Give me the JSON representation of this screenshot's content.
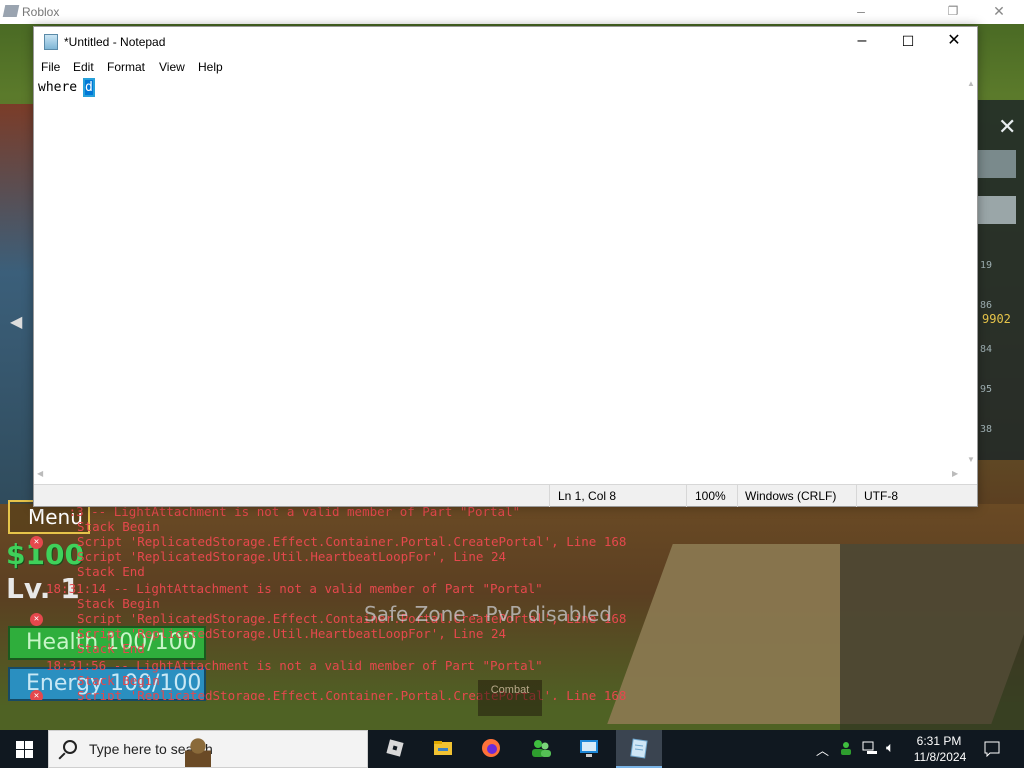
{
  "roblox": {
    "title": "Roblox",
    "hud": {
      "menu_label": "Menu",
      "money": "$100",
      "level": "Lv. 1",
      "health": "Health 100/100",
      "energy": "Energy 100/100"
    },
    "safe_zone": "Safe Zone - PvP disabled",
    "combat_label": "Combat",
    "side_panel": {
      "numbers": [
        "19",
        "86",
        "84",
        "95",
        "38"
      ],
      "gold_value": "9902"
    },
    "console_lines": [
      "   :3 -- LightAttachment is not a valid member of Part \"Portal\"",
      "  Stack Begin",
      "  Script 'ReplicatedStorage.Effect.Container.Portal.CreatePortal', Line 168",
      "  Script 'ReplicatedStorage.Util.HeartbeatLoopFor', Line 24",
      "  Stack End",
      "18:31:14 -- LightAttachment is not a valid member of Part \"Portal\"",
      "  Stack Begin",
      "  Script 'ReplicatedStorage.Effect.Container.Portal.CreatePortal', Line 168",
      "  Script 'ReplicatedStorage.Util.HeartbeatLoopFor', Line 24",
      "  Stack End",
      "18:31:56 -- LightAttachment is not a valid member of Part \"Portal\"",
      "  Stack Begin",
      "  Script 'ReplicatedStorage.Effect.Container.Portal.CreatePortal', Line 168"
    ]
  },
  "notepad": {
    "title": "*Untitled - Notepad",
    "menu": [
      "File",
      "Edit",
      "Format",
      "View",
      "Help"
    ],
    "text_before": "where ",
    "text_selected": "d",
    "status": {
      "position": "Ln 1, Col 8",
      "zoom": "100%",
      "line_endings": "Windows (CRLF)",
      "encoding": "UTF-8"
    }
  },
  "taskbar": {
    "search_placeholder": "Type here to search",
    "apps": [
      "roblox-icon",
      "file-explorer-icon",
      "firefox-icon",
      "contacts-icon",
      "remote-desktop-icon",
      "notepad-icon"
    ],
    "clock_time": "6:31 PM",
    "clock_date": "11/8/2024"
  },
  "colors": {
    "console_error": "#e5484d",
    "selection": "#0078d7",
    "taskbar": "#101820"
  }
}
